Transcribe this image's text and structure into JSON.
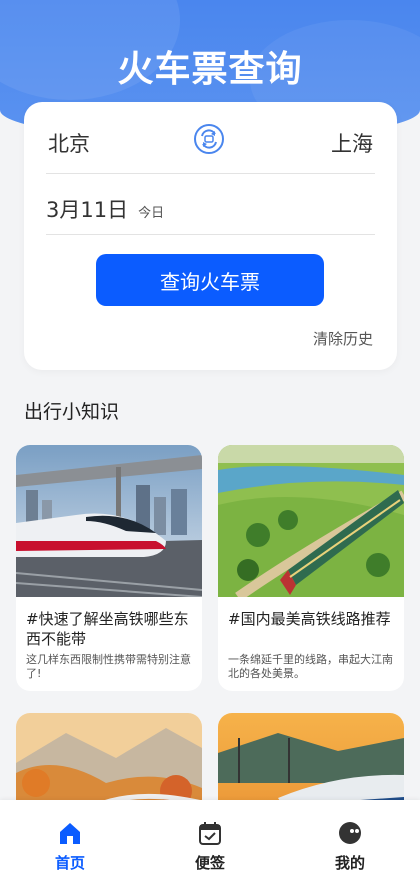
{
  "header": {
    "title": "火车票查询"
  },
  "search": {
    "from_city": "北京",
    "to_city": "上海",
    "date": "3月11日",
    "date_hint": "今日",
    "button_label": "查询火车票",
    "clear_label": "清除历史"
  },
  "tips": {
    "title": "出行小知识",
    "articles": [
      {
        "title": "#快速了解坐高铁哪些东西不能带",
        "desc": "这几样东西限制性携带需特别注意了!"
      },
      {
        "title": "#国内最美高铁线路推荐",
        "desc": "一条绵延千里的线路，串起大江南北的各处美景。"
      },
      {
        "title": "",
        "desc": ""
      },
      {
        "title": "",
        "desc": ""
      }
    ]
  },
  "tabbar": {
    "items": [
      {
        "label": "首页",
        "icon": "home-icon",
        "active": true
      },
      {
        "label": "便签",
        "icon": "calendar-check-icon",
        "active": false
      },
      {
        "label": "我的",
        "icon": "profile-icon",
        "active": false
      }
    ]
  },
  "colors": {
    "primary": "#0b5cff",
    "header": "#4a86ee",
    "background": "#f3f4f6"
  }
}
